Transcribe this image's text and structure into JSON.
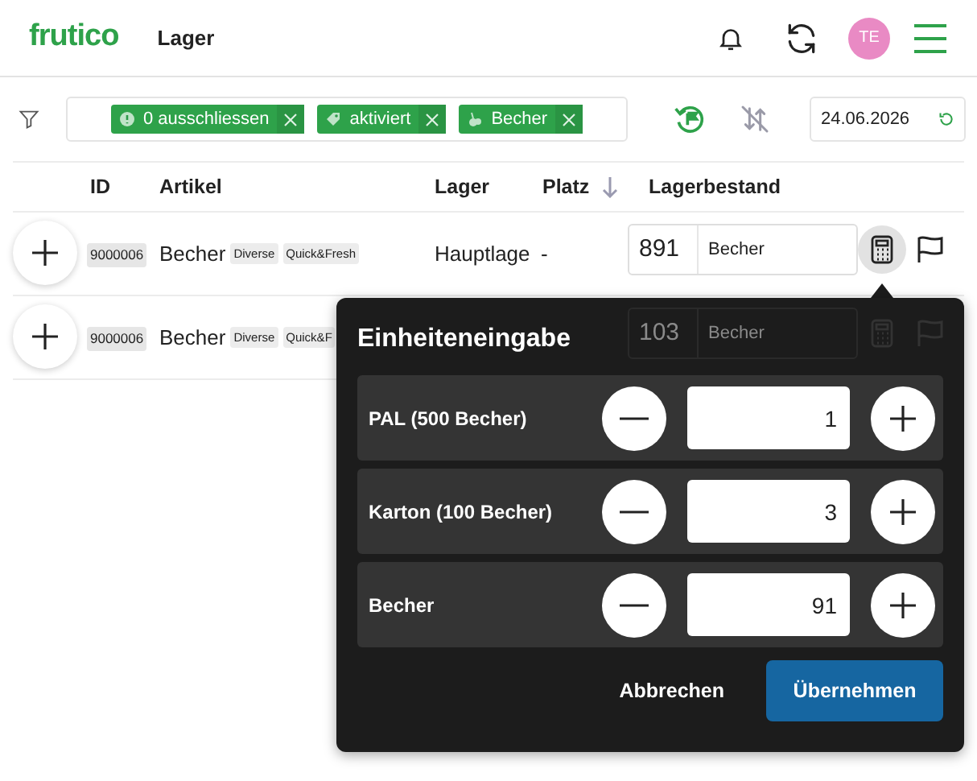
{
  "header": {
    "logo": "frutico",
    "title": "Lager",
    "avatar": "TE"
  },
  "filter": {
    "chips": [
      {
        "kind": "exclude",
        "label": "0 ausschliessen"
      },
      {
        "kind": "status",
        "label": "aktiviert"
      },
      {
        "kind": "category",
        "label": "Becher"
      }
    ],
    "date": "24.06.2026"
  },
  "table": {
    "columns": [
      {
        "label": "ID",
        "sorted": false
      },
      {
        "label": "Artikel",
        "sorted": false
      },
      {
        "label": "Lager",
        "sorted": false
      },
      {
        "label": "Platz",
        "sorted": true
      },
      {
        "label": "Lagerbestand",
        "sorted": false
      }
    ],
    "rows": [
      {
        "id": "9000006",
        "name": "Becher",
        "tags": [
          "Diverse",
          "Quick&Fresh"
        ],
        "lager": "Hauptlage",
        "platz": "-",
        "quantity": "891",
        "unit": "Becher",
        "active": true
      },
      {
        "id": "9000006",
        "name": "Becher",
        "tags": [
          "Diverse",
          "Quick&F"
        ],
        "quantity": "103",
        "unit": "Becher",
        "active": false
      }
    ]
  },
  "popover": {
    "title": "Einheiteneingabe",
    "rows": [
      {
        "label": "PAL (500 Becher)",
        "value": "1"
      },
      {
        "label": "Karton (100 Becher)",
        "value": "3"
      },
      {
        "label": "Becher",
        "value": "91"
      }
    ],
    "cancel": "Abbrechen",
    "confirm": "Übernehmen"
  }
}
